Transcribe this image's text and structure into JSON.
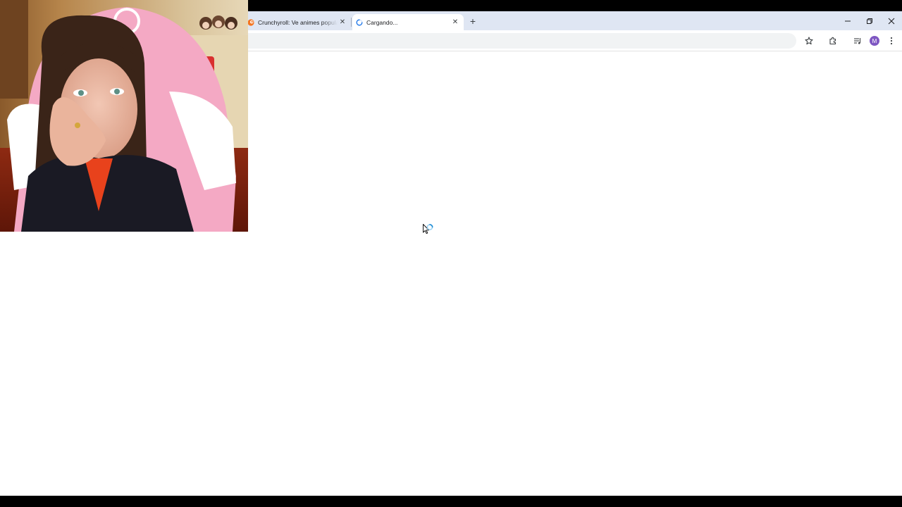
{
  "browser": {
    "tabs": [
      {
        "title": "Crunchyroll: Ve animes populares",
        "state": "inactive",
        "favicon": "crunchyroll-logo-icon"
      },
      {
        "title": "Cargando...",
        "state": "active-loading",
        "favicon": "loading-spinner-icon"
      }
    ],
    "new_tab_icon": "plus-icon",
    "window_controls": [
      "minimize-icon",
      "restore-icon",
      "close-icon"
    ],
    "toolbar_icons": [
      "bookmark-star-icon",
      "extensions-puzzle-icon",
      "media-playlist-icon",
      "kebab-menu-icon"
    ],
    "profile_initial": "M",
    "accent_color": "#1a73e8",
    "tabstrip_color": "#dfe6f3"
  },
  "page": {
    "state": "loading",
    "background": "#ffffff"
  },
  "overlay": {
    "webcam": "streamer webcam overlay (woman in pink gaming chair)"
  }
}
